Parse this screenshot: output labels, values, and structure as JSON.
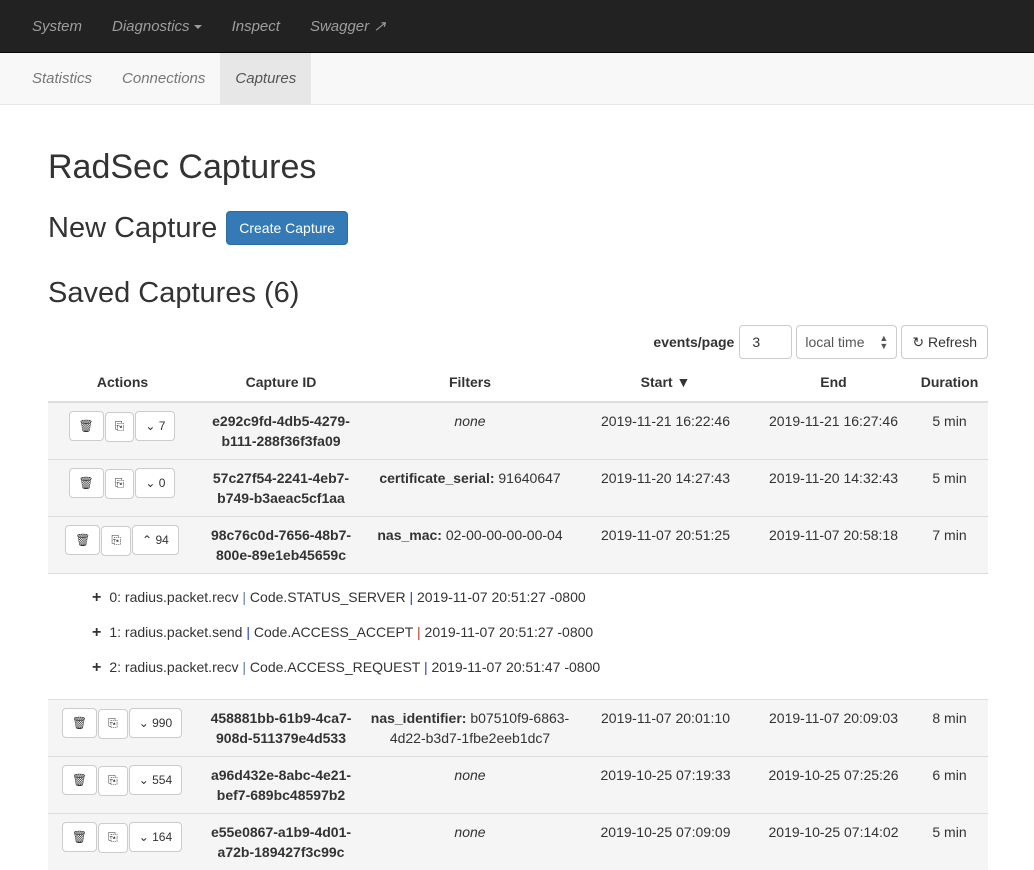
{
  "topnav": [
    "System",
    "Diagnostics",
    "Inspect",
    "Swagger"
  ],
  "subnav": [
    "Statistics",
    "Connections",
    "Captures"
  ],
  "title": "RadSec Captures",
  "new_capture": "New Capture",
  "create_button": "Create Capture",
  "saved_title": "Saved Captures (6)",
  "controls": {
    "events_label": "events/page",
    "events_value": "3",
    "tz": "local time",
    "refresh": "Refresh"
  },
  "columns": [
    "Actions",
    "Capture ID",
    "Filters",
    "Start ▼",
    "End",
    "Duration"
  ],
  "rows": [
    {
      "count": "7",
      "id1": "e292c9fd-4db5-4279-",
      "id2": "b111-288f36f3fa09",
      "fkey": "",
      "fval": "none",
      "start": "2019-11-21 16:22:46",
      "end": "2019-11-21 16:27:46",
      "dur": "5 min",
      "expanded": false
    },
    {
      "count": "0",
      "id1": "57c27f54-2241-4eb7-",
      "id2": "b749-b3aeac5cf1aa",
      "fkey": "certificate_serial:",
      "fval": " 91640647",
      "start": "2019-11-20 14:27:43",
      "end": "2019-11-20 14:32:43",
      "dur": "5 min",
      "expanded": false
    },
    {
      "count": "94",
      "id1": "98c76c0d-7656-48b7-",
      "id2": "800e-89e1eb45659c",
      "fkey": "nas_mac:",
      "fval": " 02-00-00-00-00-04",
      "start": "2019-11-07 20:51:25",
      "end": "2019-11-07 20:58:18",
      "dur": "7 min",
      "expanded": true
    },
    {
      "count": "990",
      "id1": "458881bb-61b9-4ca7-",
      "id2": "908d-511379e4d533",
      "fkey": "nas_identifier:",
      "fval": " b07510f9-6863-4d22-b3d7-1fbe2eeb1dc7",
      "start": "2019-11-07 20:01:10",
      "end": "2019-11-07 20:09:03",
      "dur": "8 min",
      "expanded": false
    },
    {
      "count": "554",
      "id1": "a96d432e-8abc-4e21-",
      "id2": "bef7-689bc48597b2",
      "fkey": "",
      "fval": "none",
      "start": "2019-10-25 07:19:33",
      "end": "2019-10-25 07:25:26",
      "dur": "6 min",
      "expanded": false
    },
    {
      "count": "164",
      "id1": "e55e0867-a1b9-4d01-",
      "id2": "a72b-189427f3c99c",
      "fkey": "",
      "fval": "none",
      "start": "2019-10-25 07:09:09",
      "end": "2019-10-25 07:14:02",
      "dur": "5 min",
      "expanded": false
    }
  ],
  "events": [
    {
      "a": "0: radius.packet.recv ",
      "b": " Code.STATUS_SERVER ",
      "c": " 2019-11-07 20:51:27 -0800"
    },
    {
      "a": "1: radius.packet.send ",
      "b": " Code.ACCESS_ACCEPT ",
      "c": " 2019-11-07 20:51:27 -0800"
    },
    {
      "a": "2: radius.packet.recv ",
      "b": " Code.ACCESS_REQUEST ",
      "c": " 2019-11-07 20:51:47 -0800"
    }
  ]
}
